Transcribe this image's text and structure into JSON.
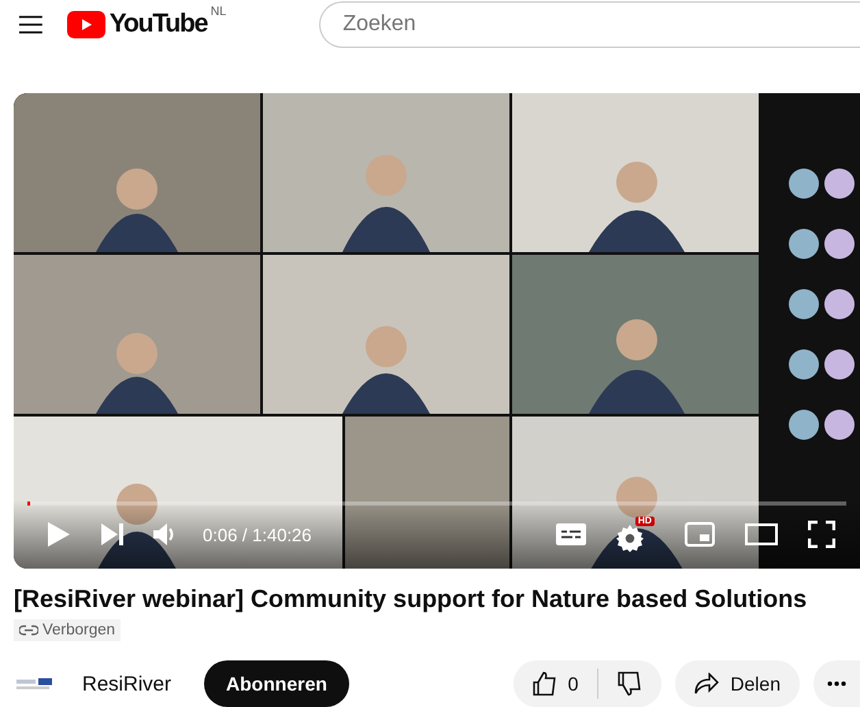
{
  "header": {
    "logo_text": "YouTube",
    "region": "NL",
    "search": {
      "placeholder": "Zoeken"
    }
  },
  "player": {
    "progress": {
      "level": 0.002
    },
    "time": "0:06 / 1:40:26",
    "muted": false,
    "hd": "HD"
  },
  "video_title": "[ResiRiver webinar] Community support for Nature based Solutions",
  "visibility": "Verborgen",
  "channel": {
    "name": "ResiRiver",
    "subscribe": "Abonneren"
  },
  "actions": {
    "likes": "0",
    "share": "Delen"
  }
}
